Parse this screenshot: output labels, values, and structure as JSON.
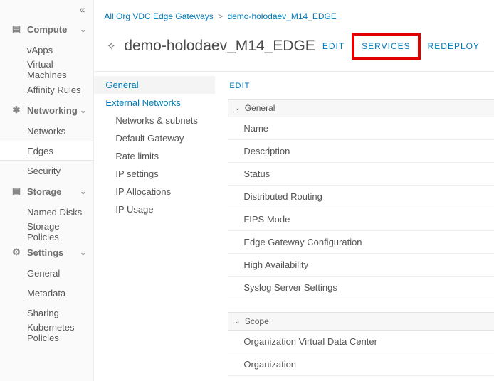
{
  "sidebar": {
    "sections": [
      {
        "icon": "▤",
        "label": "Compute",
        "items": [
          "vApps",
          "Virtual Machines",
          "Affinity Rules"
        ]
      },
      {
        "icon": "✱",
        "label": "Networking",
        "items": [
          "Networks",
          "Edges",
          "Security"
        ],
        "activeIndex": 1
      },
      {
        "icon": "▣",
        "label": "Storage",
        "items": [
          "Named Disks",
          "Storage Policies"
        ]
      },
      {
        "icon": "⚙",
        "label": "Settings",
        "items": [
          "General",
          "Metadata",
          "Sharing",
          "Kubernetes Policies"
        ]
      }
    ]
  },
  "breadcrumb": {
    "root": "All Org VDC Edge Gateways",
    "current": "demo-holodaev_M14_EDGE"
  },
  "page": {
    "title": "demo-holodaev_M14_EDGE",
    "actions": {
      "edit": "EDIT",
      "services": "SERVICES",
      "redeploy": "REDEPLOY"
    }
  },
  "subnav": {
    "top": "General",
    "group": "External Networks",
    "children": [
      "Networks & subnets",
      "Default Gateway",
      "Rate limits",
      "IP settings",
      "IP Allocations",
      "IP Usage"
    ]
  },
  "detail": {
    "editLabel": "EDIT",
    "groups": [
      {
        "title": "General",
        "rows": [
          "Name",
          "Description",
          "Status",
          "Distributed Routing",
          "FIPS Mode",
          "Edge Gateway Configuration",
          "High Availability",
          "Syslog Server Settings"
        ]
      },
      {
        "title": "Scope",
        "rows": [
          "Organization Virtual Data Center",
          "Organization"
        ]
      }
    ]
  }
}
